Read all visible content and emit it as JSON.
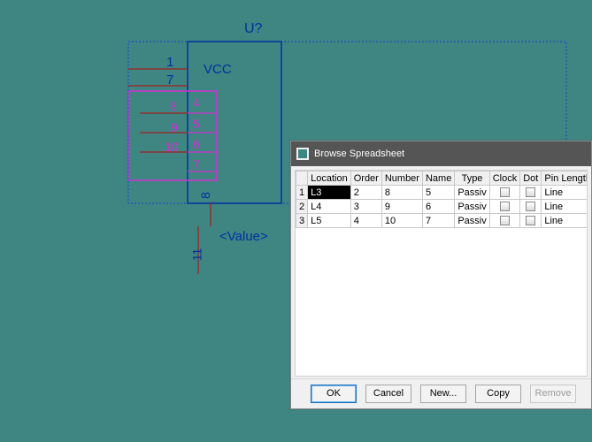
{
  "schematic": {
    "refdes": "U?",
    "value_label": "<Value>",
    "primary_label": "VCC",
    "pins_dark": {
      "p1": "1",
      "p7": "7",
      "p8_side": "8",
      "p11": "11"
    },
    "pins_magenta": {
      "p4": "4",
      "p5": "5",
      "p6": "6",
      "p7": "7",
      "p8": "8",
      "p9": "9",
      "p10": "10"
    }
  },
  "dialog": {
    "title": "Browse Spreadsheet",
    "columns": [
      "Location",
      "Order",
      "Number",
      "Name",
      "Type",
      "Clock",
      "Dot",
      "Pin Length"
    ],
    "rows": [
      {
        "idx": "1",
        "Location": "L3",
        "Order": "2",
        "Number": "8",
        "Name": "5",
        "Type": "Passiv",
        "Clock": false,
        "Dot": false,
        "PinLength": "Line"
      },
      {
        "idx": "2",
        "Location": "L4",
        "Order": "3",
        "Number": "9",
        "Name": "6",
        "Type": "Passiv",
        "Clock": false,
        "Dot": false,
        "PinLength": "Line"
      },
      {
        "idx": "3",
        "Location": "L5",
        "Order": "4",
        "Number": "10",
        "Name": "7",
        "Type": "Passiv",
        "Clock": false,
        "Dot": false,
        "PinLength": "Line"
      }
    ],
    "buttons": {
      "ok": "OK",
      "cancel": "Cancel",
      "new": "New...",
      "copy": "Copy",
      "remove": "Remove"
    }
  }
}
